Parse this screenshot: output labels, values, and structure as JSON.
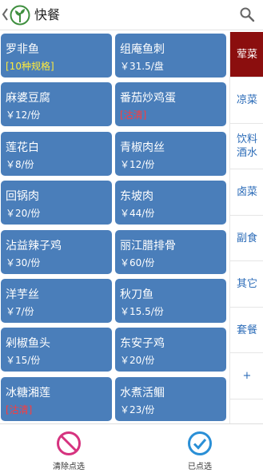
{
  "header": {
    "title": "快餐",
    "logo_icon": "tree-leaf-logo-icon",
    "search_icon": "search-icon"
  },
  "menu_items": [
    {
      "name": "罗非鱼",
      "sub": "[10种规格]",
      "sub_color": "yellow"
    },
    {
      "name": "组庵鱼刺",
      "sub": "￥31.5/盘",
      "sub_color": "white"
    },
    {
      "name": "麻婆豆腐",
      "sub": "￥12/份",
      "sub_color": "white"
    },
    {
      "name": "番茄炒鸡蛋",
      "sub": "[沽清]",
      "sub_color": "red"
    },
    {
      "name": "莲花白",
      "sub": "￥8/份",
      "sub_color": "white"
    },
    {
      "name": "青椒肉丝",
      "sub": "￥12/份",
      "sub_color": "white"
    },
    {
      "name": "回锅肉",
      "sub": "￥20/份",
      "sub_color": "white"
    },
    {
      "name": "东坡肉",
      "sub": "￥44/份",
      "sub_color": "white"
    },
    {
      "name": "沾益辣子鸡",
      "sub": "￥30/份",
      "sub_color": "white"
    },
    {
      "name": "丽江腊排骨",
      "sub": "￥60/份",
      "sub_color": "white"
    },
    {
      "name": "洋芋丝",
      "sub": "￥7/份",
      "sub_color": "white"
    },
    {
      "name": "秋刀鱼",
      "sub": "￥15.5/份",
      "sub_color": "white"
    },
    {
      "name": "剁椒鱼头",
      "sub": "￥15/份",
      "sub_color": "white"
    },
    {
      "name": "东安子鸡",
      "sub": "￥20/份",
      "sub_color": "white"
    },
    {
      "name": "冰糖湘莲",
      "sub": "[沽清]",
      "sub_color": "red"
    },
    {
      "name": "水煮活鲴",
      "sub": "￥23/份",
      "sub_color": "white"
    }
  ],
  "categories": [
    {
      "label": "荤菜",
      "active": true
    },
    {
      "label": "凉菜",
      "active": false
    },
    {
      "label": "饮料酒水",
      "active": false
    },
    {
      "label": "卤菜",
      "active": false
    },
    {
      "label": "副食",
      "active": false
    },
    {
      "label": "其它",
      "active": false
    },
    {
      "label": "套餐",
      "active": false
    },
    {
      "label": "+",
      "active": false
    }
  ],
  "bottom_bar": {
    "clear_label": "清除点选",
    "clear_icon": "no-entry-icon",
    "selected_label": "已点选",
    "selected_icon": "check-circle-icon"
  },
  "colors": {
    "card_bg": "#4a7eba",
    "active_category_bg": "#8b0e0e",
    "category_text": "#2c6cb8",
    "clear_icon": "#d6337f",
    "selected_icon": "#2a8fd6",
    "logo_green": "#3f8f3f"
  }
}
